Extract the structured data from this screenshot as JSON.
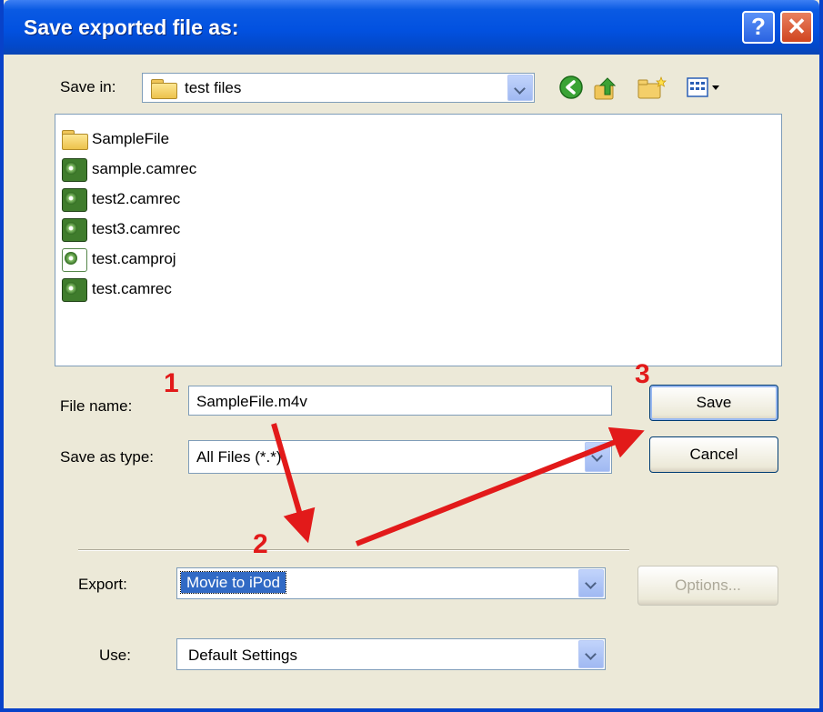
{
  "dialog": {
    "title": "Save exported file as:",
    "help_label": "?",
    "close_label": "✕"
  },
  "save_in": {
    "label": "Save in:",
    "value": "test files"
  },
  "files": [
    {
      "name": "SampleFile",
      "icon": "folder-icon"
    },
    {
      "name": "sample.camrec",
      "icon": "camrec-file-icon"
    },
    {
      "name": "test2.camrec",
      "icon": "camrec-file-icon"
    },
    {
      "name": "test3.camrec",
      "icon": "camrec-file-icon"
    },
    {
      "name": "test.camproj",
      "icon": "camproj-file-icon"
    },
    {
      "name": "test.camrec",
      "icon": "camrec-file-icon"
    }
  ],
  "file_name": {
    "label": "File name:",
    "value": "SampleFile.m4v"
  },
  "save_as_type": {
    "label": "Save as type:",
    "value": "All Files (*.*)"
  },
  "buttons": {
    "save": "Save",
    "cancel": "Cancel",
    "options": "Options..."
  },
  "export": {
    "label": "Export:",
    "value": "Movie to iPod"
  },
  "use": {
    "label": "Use:",
    "value": "Default Settings"
  },
  "annotations": {
    "step1": "1",
    "step2": "2",
    "step3": "3",
    "color": "#e21a1a"
  }
}
